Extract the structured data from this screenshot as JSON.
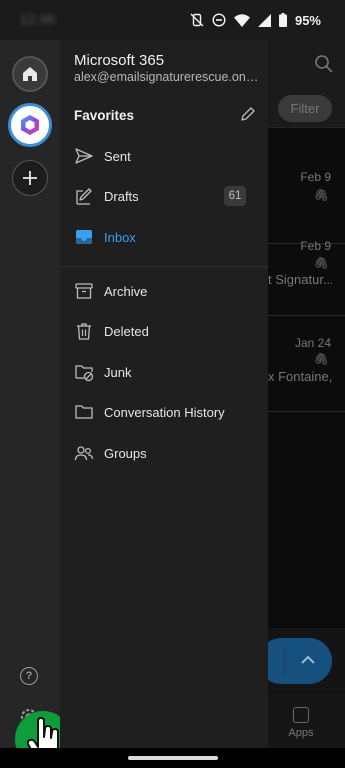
{
  "status_bar": {
    "time": "12:46",
    "battery_percent": "95%",
    "icons": [
      "vibrate-off-icon",
      "do-not-disturb-icon",
      "wifi-icon",
      "signal-icon",
      "battery-icon"
    ]
  },
  "account": {
    "name": "Microsoft 365",
    "email": "alex@emailsignaturerescue.onmicrosoft.com"
  },
  "favorites": {
    "title": "Favorites",
    "folders": [
      {
        "label": "Sent",
        "icon": "send-icon"
      },
      {
        "label": "Drafts",
        "icon": "drafts-icon",
        "count": "61"
      },
      {
        "label": "Inbox",
        "icon": "inbox-icon",
        "active": true
      }
    ]
  },
  "folders": [
    {
      "label": "Archive",
      "icon": "archive-icon"
    },
    {
      "label": "Deleted",
      "icon": "trash-icon"
    },
    {
      "label": "Junk",
      "icon": "junk-folder-icon"
    },
    {
      "label": "Conversation History",
      "icon": "folder-icon"
    },
    {
      "label": "Groups",
      "icon": "groups-icon"
    }
  ],
  "background_app": {
    "filter_label": "Filter",
    "messages": [
      {
        "date": "Feb 9",
        "snippet": ""
      },
      {
        "date": "Feb 9",
        "snippet": "t Signatur..."
      },
      {
        "date": "Jan 24",
        "snippet": "x Fontaine,..."
      }
    ],
    "bottom_nav": {
      "apps_label": "Apps"
    }
  },
  "colors": {
    "accent": "#3a9ff0",
    "drawer_bg": "#1f1f1f",
    "rail_bg": "#262626",
    "tap_indicator": "#0f9d3c"
  }
}
